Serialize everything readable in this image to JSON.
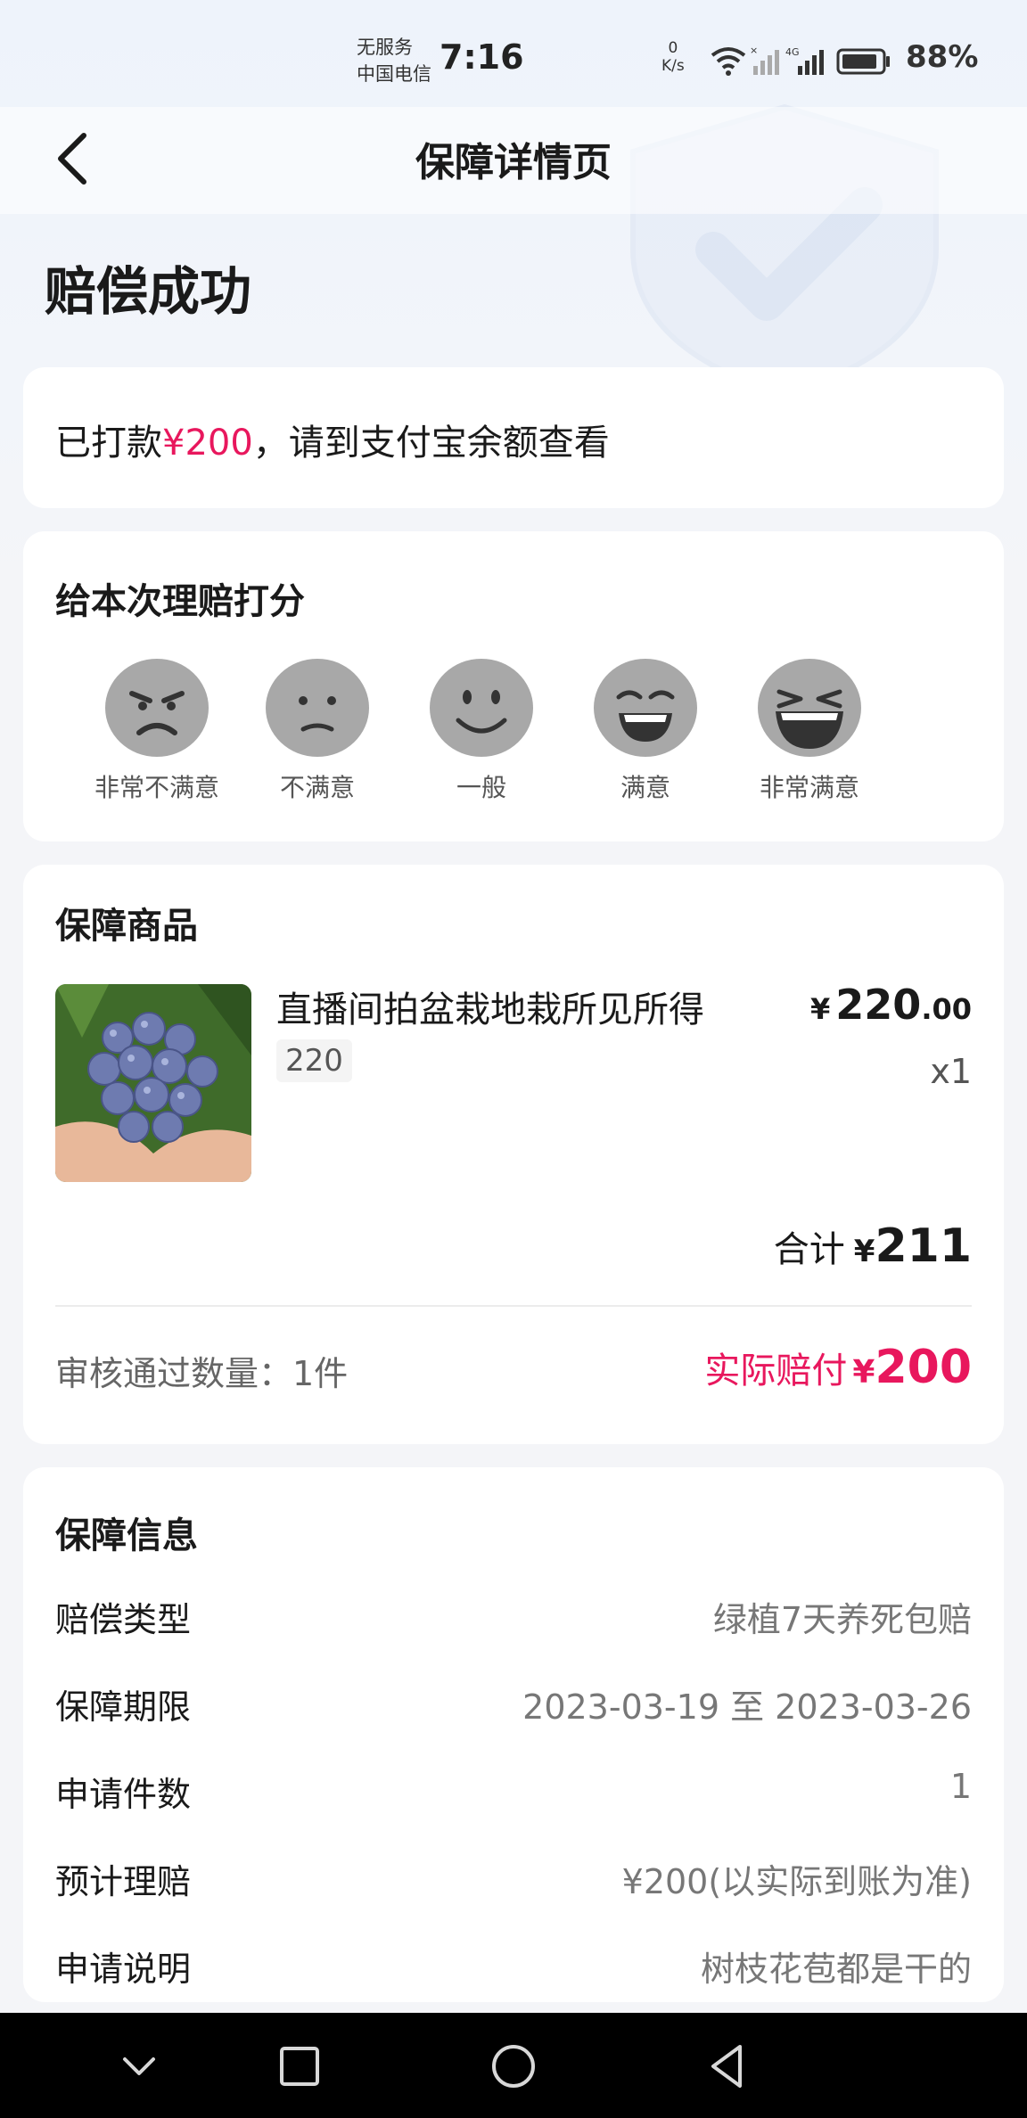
{
  "status_bar": {
    "carrier_line1": "无服务",
    "carrier_line2": "中国电信",
    "time": "7:16",
    "net_speed_value": "0",
    "net_speed_unit": "K/s",
    "signal_label": "4G",
    "battery": "88%"
  },
  "nav": {
    "title": "保障详情页",
    "back_icon": "chevron-left-icon"
  },
  "page_heading": "赔偿成功",
  "payout": {
    "prefix": "已打款",
    "amount": "¥200",
    "suffix": "，请到支付宝余额查看"
  },
  "rating": {
    "title": "给本次理赔打分",
    "options": [
      {
        "label": "非常不满意",
        "icon": "angry-face-icon"
      },
      {
        "label": "不满意",
        "icon": "frown-face-icon"
      },
      {
        "label": "一般",
        "icon": "smile-face-icon"
      },
      {
        "label": "满意",
        "icon": "grin-face-icon"
      },
      {
        "label": "非常满意",
        "icon": "laugh-face-icon"
      }
    ]
  },
  "goods": {
    "title": "保障商品",
    "name": "直播间拍盆栽地栽所见所得",
    "spec": "220",
    "price_currency": "¥",
    "price_int": "220",
    "price_dec": ".00",
    "qty": "x1",
    "total_label": "合计",
    "total_currency": "¥",
    "total_amount": "211",
    "approved_label": "审核通过数量：1件",
    "actual_label": "实际赔付",
    "actual_currency": "¥",
    "actual_amount": "200"
  },
  "info": {
    "title": "保障信息",
    "rows": [
      {
        "key": "赔偿类型",
        "value": "绿植7天养死包赔"
      },
      {
        "key": "保障期限",
        "value": "2023-03-19 至 2023-03-26"
      },
      {
        "key": "申请件数",
        "value": "1"
      },
      {
        "key": "预计理赔",
        "value": "¥200(以实际到账为准)"
      },
      {
        "key": "申请说明",
        "value": "树枝花苞都是干的"
      }
    ]
  },
  "colors": {
    "accent_red": "#e8175d",
    "page_bg": "#f4f5f8",
    "card_bg": "#ffffff"
  },
  "system_nav": [
    "collapse-chevron-icon",
    "recents-square-icon",
    "home-circle-icon",
    "back-triangle-icon"
  ]
}
